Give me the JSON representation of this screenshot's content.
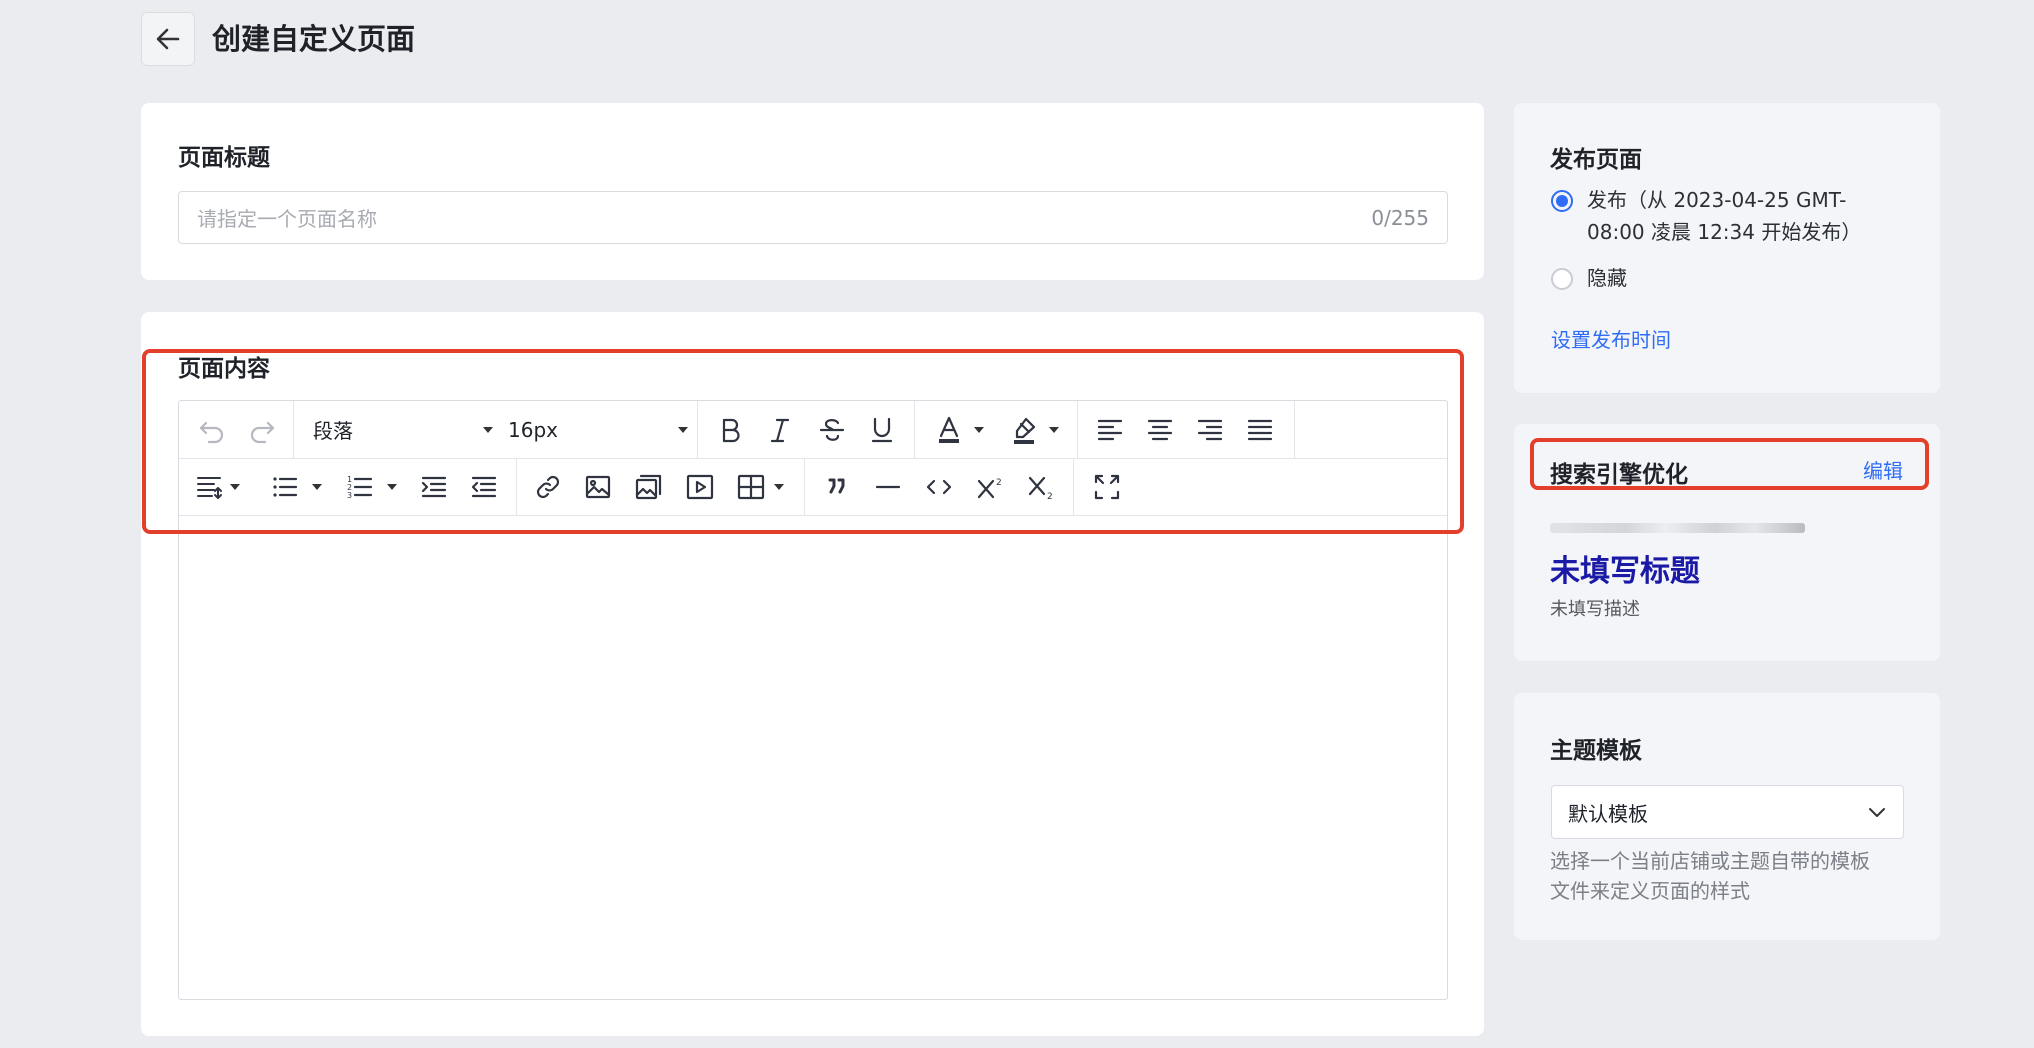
{
  "header": {
    "title": "创建自定义页面"
  },
  "page_title_card": {
    "label": "页面标题",
    "input_placeholder": "请指定一个页面名称",
    "input_value": "",
    "char_count": "0/255"
  },
  "content_card": {
    "label": "页面内容",
    "toolbar": {
      "block_format": "段落",
      "font_size": "16px",
      "tools_row1": [
        "undo-icon",
        "redo-icon",
        "bold-icon",
        "italic-icon",
        "strikethrough-icon",
        "underline-icon",
        "font-color-icon",
        "highlight-color-icon",
        "align-left-icon",
        "align-center-icon",
        "align-right-icon",
        "align-justify-icon"
      ],
      "tools_row2": [
        "line-height-icon",
        "bullet-list-icon",
        "numbered-list-icon",
        "indent-icon",
        "outdent-icon",
        "link-icon",
        "image-icon",
        "gallery-icon",
        "video-icon",
        "table-icon",
        "blockquote-icon",
        "horizontal-rule-icon",
        "code-icon",
        "superscript-icon",
        "subscript-icon",
        "fullscreen-icon"
      ]
    }
  },
  "publish_card": {
    "title": "发布页面",
    "option_publish_line1": "发布（从 2023-04-25 GMT-",
    "option_publish_line2": "08:00 凌晨 12:34 开始发布）",
    "option_hide": "隐藏",
    "selected": "publish",
    "set_time_link": "设置发布时间"
  },
  "seo_card": {
    "title": "搜索引擎优化",
    "edit_link": "编辑",
    "preview_title": "未填写标题",
    "preview_description": "未填写描述"
  },
  "template_card": {
    "title": "主题模板",
    "selected_value": "默认模板",
    "help_line1": "选择一个当前店铺或主题自带的模板",
    "help_line2": "文件来定义页面的样式"
  },
  "colors": {
    "accent": "#2f6df6",
    "highlight_box": "#e3402b",
    "seo_title": "#1a1aa6"
  }
}
